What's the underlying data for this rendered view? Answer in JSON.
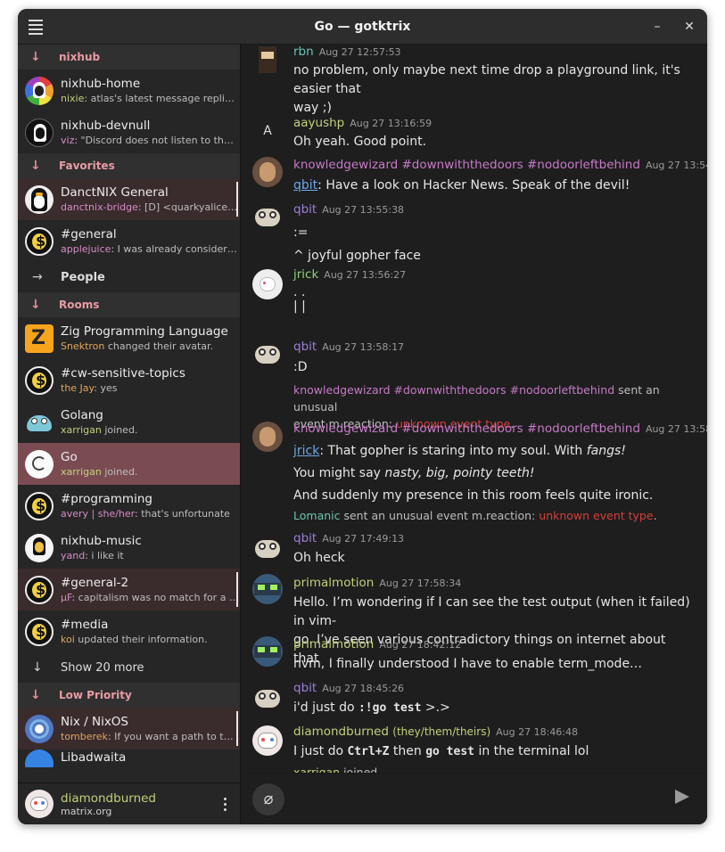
{
  "window": {
    "title": "Go — gotktrix",
    "minimize": "–",
    "close": "✕"
  },
  "sidebar": {
    "sections": [
      {
        "label": "nixhub"
      },
      {
        "label": "Favorites"
      },
      {
        "label": "People"
      },
      {
        "label": "Rooms"
      },
      {
        "label": "Low Priority"
      }
    ],
    "rooms": [
      {
        "name": "nixhub-home",
        "user": "nixie",
        "preview": ": atlas's latest message replies t…",
        "user_color": "#c2d07b"
      },
      {
        "name": "nixhub-devnull",
        "user": "viz",
        "preview": ": \"Discord does not listen to the pe…",
        "user_color": "#d78cc8"
      },
      {
        "name": "DanctNIX General",
        "user": "danctnix-bridge",
        "preview": ": [D] <quarkyalice> `…",
        "user_color": "#d78cc8"
      },
      {
        "name": "#general",
        "user": "applejuice",
        "preview": ": I was already considering …",
        "user_color": "#d78cc8"
      },
      {
        "name": "Zig Programming Language",
        "user": "Snektron",
        "preview": " changed their avatar.",
        "user_color": "#e0a65c"
      },
      {
        "name": "#cw-sensitive-topics",
        "user": "the Jay",
        "preview": ": yes",
        "user_color": "#e0a65c"
      },
      {
        "name": "Golang",
        "user": "xarrigan",
        "preview": " joined.",
        "user_color": "#c2d07b"
      },
      {
        "name": "Go",
        "user": "xarrigan",
        "preview": " joined.",
        "user_color": "#c2d07b"
      },
      {
        "name": "#programming",
        "user": "avery | she/her",
        "preview": ": that's unfortunate",
        "user_color": "#d78cc8"
      },
      {
        "name": "nixhub-music",
        "user": "yand",
        "preview": ": i like it",
        "user_color": "#d78cc8"
      },
      {
        "name": "#general-2",
        "user": "µF",
        "preview": ": capitalism was no match for a bad…",
        "user_color": "#d78cc8"
      },
      {
        "name": "#media",
        "user": "koi",
        "preview": " updated their information.",
        "user_color": "#e0a65c"
      },
      {
        "name": "Nix / NixOS",
        "user": "tomberek",
        "preview": ": If you want a path to the de…",
        "user_color": "#e0a65c"
      },
      {
        "name": "Libadwaita",
        "user": "",
        "preview": "",
        "user_color": "#c2d07b"
      }
    ],
    "show_more": "Show 20 more",
    "me": {
      "name": "diamondburned",
      "homeserver": "matrix.org"
    }
  },
  "messages": [
    {
      "author": "rbn",
      "color": "#6cc4b0",
      "time": "Aug 27 12:57:53",
      "lines": [
        "no problem, only maybe next time drop a playground link, it's easier that",
        "way ;)"
      ]
    },
    {
      "author": "aayushp",
      "color": "#c2d07b",
      "time": "Aug 27 13:16:59",
      "avatar_letter": "A",
      "lines": [
        "Oh yeah. Good point."
      ]
    },
    {
      "author": "knowledgewizard #downwiththedoors #nodoorleftbehind",
      "color": "#c77ac8",
      "time": "Aug 27 13:54:35",
      "mention": "qbit",
      "text": ": Have a look on Hacker News.  Speak of the devil!"
    },
    {
      "author": "qbit",
      "color": "#9a7fd8",
      "time": "Aug 27 13:55:38",
      "lines": [
        ":=",
        "^ joyful gopher face"
      ]
    },
    {
      "author": "jrick",
      "color": "#8fd07b",
      "time": "Aug 27 13:56:27",
      "lines": [
        ". .",
        "| |"
      ]
    },
    {
      "author": "qbit",
      "color": "#9a7fd8",
      "time": "Aug 27 13:58:17",
      "lines": [
        ":D"
      ]
    },
    {
      "event_user": "knowledgewizard #downwiththedoors #nodoorleftbehind",
      "event_text": " sent an unusual",
      "event_text2": "event m.reaction: ",
      "event_red": "unknown event type",
      "event_tail": "."
    },
    {
      "author": "knowledgewizard #downwiththedoors #nodoorleftbehind",
      "color": "#c77ac8",
      "time": "Aug 27 13:58:39",
      "mention": "jrick",
      "text": ": That gopher is staring into my soul.  With ",
      "em": "fangs!",
      "line2a": "You might say ",
      "line2em": "nasty, big, pointy teeth!",
      "line3": "And suddenly my presence in this room feels quite ironic."
    },
    {
      "event_user": "Lomanic",
      "event_text": " sent an unusual event m.reaction: ",
      "event_red": "unknown event type",
      "event_tail": "."
    },
    {
      "author": "qbit",
      "color": "#9a7fd8",
      "time": "Aug 27 17:49:13",
      "lines": [
        "Oh heck"
      ]
    },
    {
      "author": "primalmotion",
      "color": "#c2d07b",
      "time": "Aug 27 17:58:34",
      "lines": [
        "Hello. I’m wondering if I can see the test output (when it failed) in vim-",
        "go. I’ve seen various contradictory things on internet about that"
      ]
    },
    {
      "author": "primalmotion",
      "color": "#c2d07b",
      "time": "Aug 27 18:42:12",
      "lines": [
        "nvm, I finally understood I have to enable term_mode…"
      ]
    },
    {
      "author": "qbit",
      "color": "#9a7fd8",
      "time": "Aug 27 18:45:26",
      "pre": "i'd just do ",
      "code": ":!go test",
      "post": " >.>"
    },
    {
      "author": "diamondburned",
      "pronouns": "(they/them/theirs)",
      "color": "#c2d07b",
      "time": "Aug 27 18:46:48",
      "pre": "I just do ",
      "code": "Ctrl+Z",
      "mid": " then ",
      "code2": "go test",
      "post": " in the terminal lol"
    },
    {
      "event_user": "xarrigan",
      "event_text": " joined."
    }
  ],
  "colors": {
    "accent": "#e89ba4",
    "selected": "#7a4c52",
    "unread_bg": "#3a2b2d"
  },
  "icons": {
    "menu": "hamburger-icon",
    "attach": "paperclip-icon",
    "send": "send-icon"
  }
}
